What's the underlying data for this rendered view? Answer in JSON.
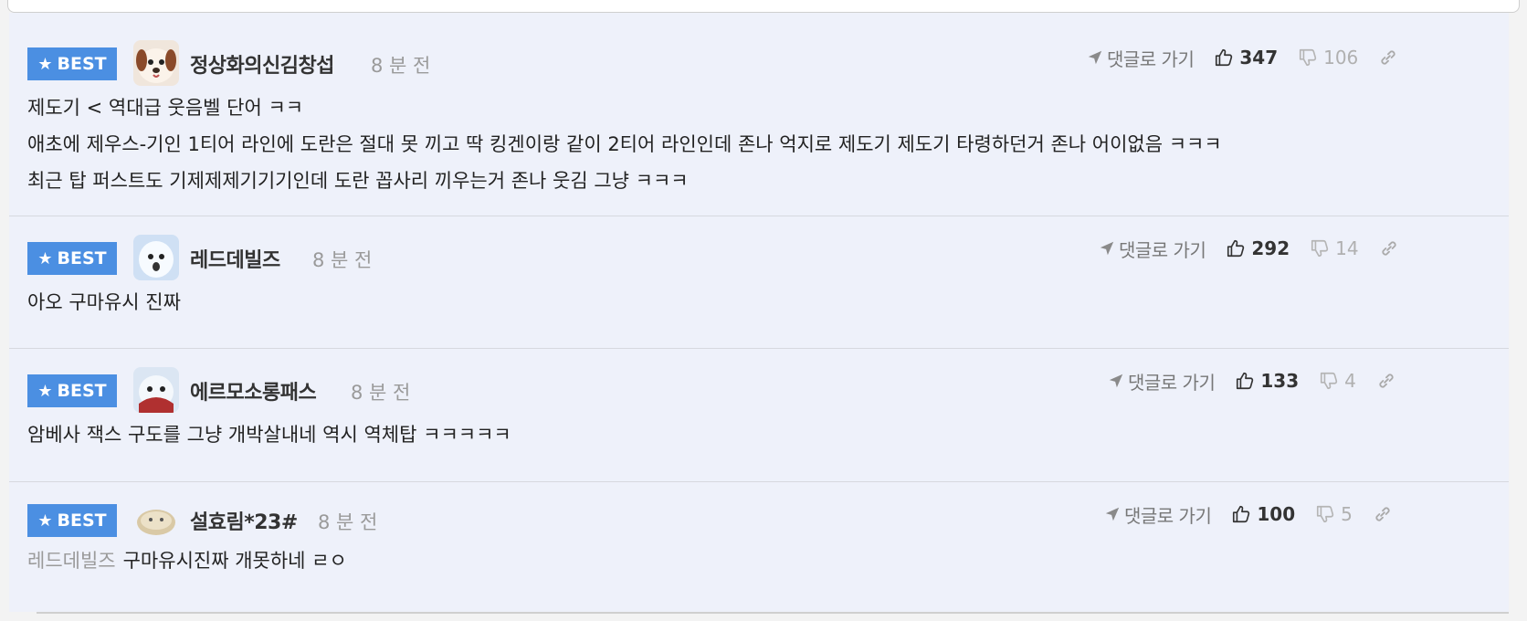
{
  "comments": [
    {
      "badge": "BEST",
      "nickname": "정상화의신김창섭",
      "time": "8 분 전",
      "goto_label": "댓글로 가기",
      "upvotes": "347",
      "downvotes": "106",
      "lines": [
        "제도기 < 역대급 웃음벨 단어 ㅋㅋ",
        "애초에 제우스-기인 1티어 라인에 도란은 절대 못 끼고 딱 킹겐이랑 같이 2티어 라인인데 존나 억지로 제도기 제도기 타령하던거 존나 어이없음 ㅋㅋㅋ",
        "최근 탑 퍼스트도 기제제제기기기인데 도란 꼽사리 끼우는거 존나 웃김 그냥 ㅋㅋㅋ"
      ]
    },
    {
      "badge": "BEST",
      "nickname": "레드데빌즈",
      "time": "8 분 전",
      "goto_label": "댓글로 가기",
      "upvotes": "292",
      "downvotes": "14",
      "lines": [
        "아오 구마유시 진짜"
      ]
    },
    {
      "badge": "BEST",
      "nickname": "에르모소롱패스",
      "time": "8 분 전",
      "goto_label": "댓글로 가기",
      "upvotes": "133",
      "downvotes": "4",
      "lines": [
        "암베사 잭스 구도를 그냥 개박살내네 역시 역체탑 ㅋㅋㅋㅋㅋ"
      ]
    },
    {
      "badge": "BEST",
      "nickname": "설효림*23#",
      "time": "8 분 전",
      "goto_label": "댓글로 가기",
      "upvotes": "100",
      "downvotes": "5",
      "reply_to": "레드데빌즈",
      "lines": [
        "구마유시진짜 개못하네 ㄹㅇ"
      ]
    }
  ],
  "colors": {
    "best_badge": "#4b8fe2",
    "list_background": "#eef1fa",
    "muted_text": "#9a9a9a"
  },
  "icons": {
    "badge": "star-icon",
    "goto": "send-arrow-icon",
    "upvote": "thumbs-up-icon",
    "downvote": "thumbs-down-icon",
    "link": "link-icon"
  }
}
